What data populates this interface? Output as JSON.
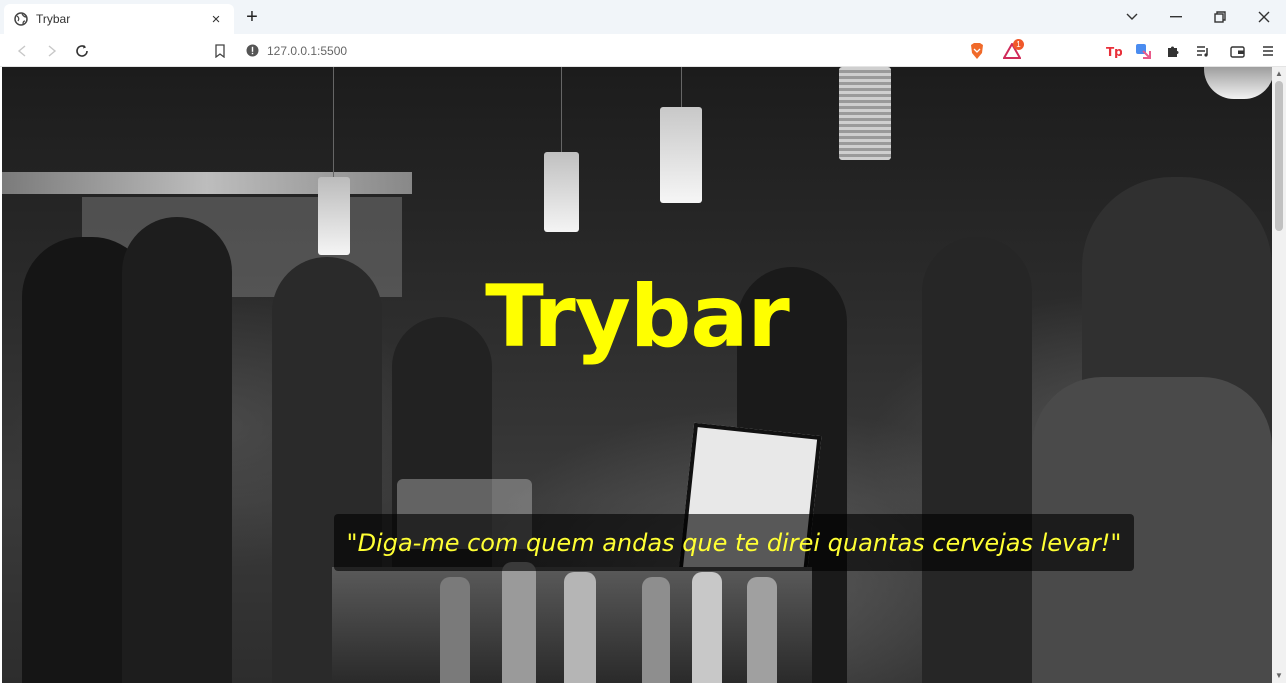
{
  "browser": {
    "tab_title": "Trybar",
    "tab_close": "×",
    "new_tab": "+",
    "url": "127.0.0.1:5500",
    "brave_badge_count": "1"
  },
  "page": {
    "title": "Trybar",
    "quote": "\"Diga-me com quem andas que te direi quantas cervejas levar!\""
  },
  "colors": {
    "title": "#ffff00",
    "quote": "#ffff33"
  }
}
